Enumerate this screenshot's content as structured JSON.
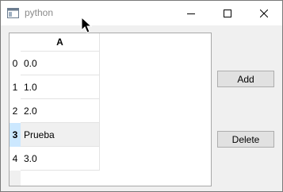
{
  "window": {
    "title": "python",
    "controls": [
      "minimize-icon",
      "maximize-icon",
      "close-icon"
    ]
  },
  "table": {
    "column_header": "A",
    "row_headers": [
      "0",
      "1",
      "2",
      "3",
      "4"
    ],
    "cells": [
      "0.0",
      "1.0",
      "2.0",
      "Prueba",
      "3.0"
    ],
    "current_row": 3
  },
  "buttons": {
    "add_label": "Add",
    "delete_label": "Delete"
  },
  "colors": {
    "selected_row_header": "#cce8ff",
    "current_row_cell": "#f0f0f0",
    "button_face": "#e1e1e1"
  }
}
